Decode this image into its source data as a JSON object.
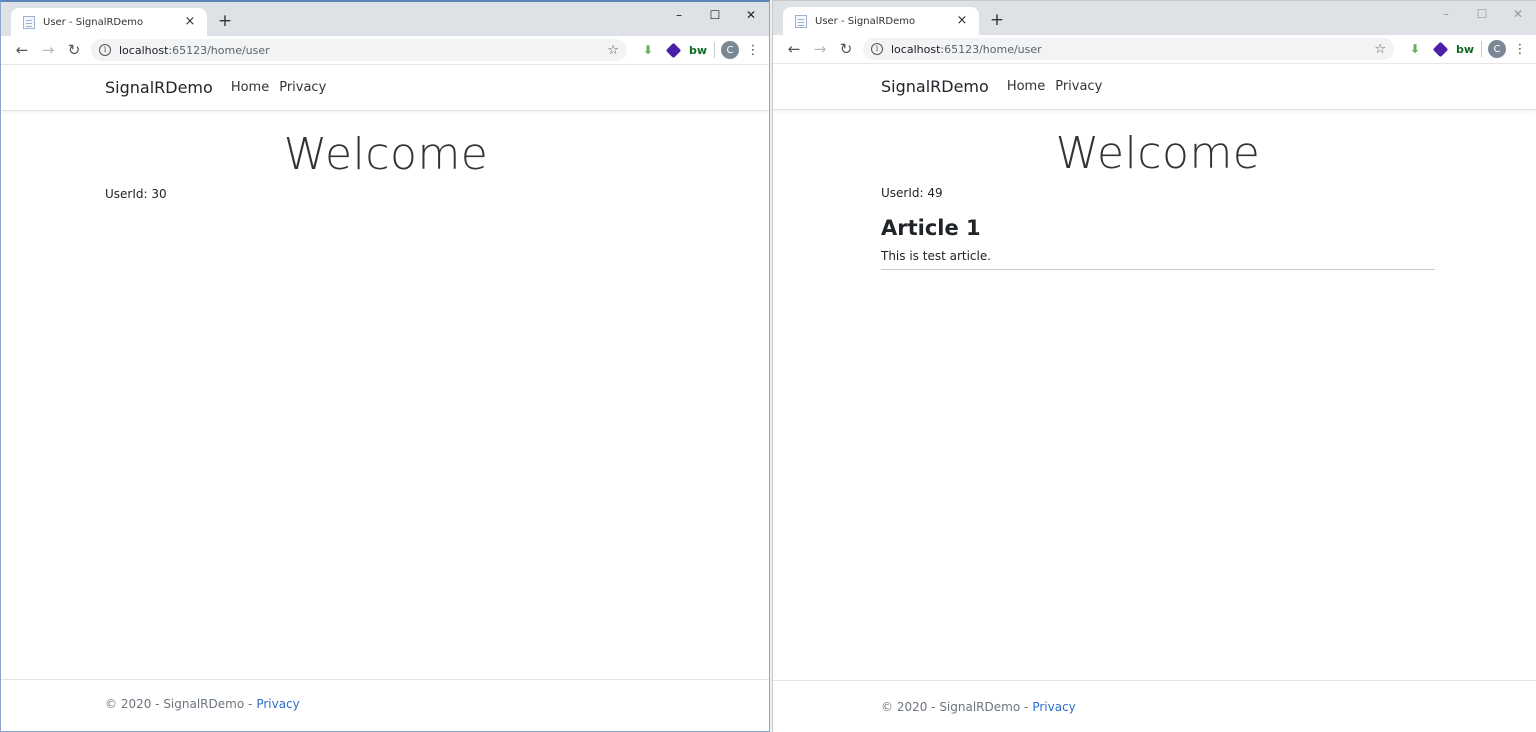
{
  "left": {
    "tab_title": "User - SignalRDemo",
    "url_host": "localhost",
    "url_path": ":65123/home/user",
    "avatar_letter": "C",
    "brand": "SignalRDemo",
    "nav": [
      "Home",
      "Privacy"
    ],
    "heading": "Welcome",
    "userid": "UserId: 30",
    "footer_text": "© 2020 - SignalRDemo -",
    "footer_link": "Privacy"
  },
  "right": {
    "tab_title": "User - SignalRDemo",
    "url_host": "localhost",
    "url_path": ":65123/home/user",
    "avatar_letter": "C",
    "brand": "SignalRDemo",
    "nav": [
      "Home",
      "Privacy"
    ],
    "heading": "Welcome",
    "userid": "UserId: 49",
    "article_title": "Article 1",
    "article_body": "This is test article.",
    "footer_text": "© 2020 - SignalRDemo -",
    "footer_link": "Privacy"
  },
  "icons": {
    "close": "×",
    "newtab": "+",
    "minimize": "–",
    "maximize": "☐",
    "window_close": "✕",
    "back": "←",
    "forward": "→",
    "reload": "↻",
    "info": "i",
    "star": "☆",
    "inbox": "⬇",
    "bw": "bw",
    "menu": "⋮"
  }
}
